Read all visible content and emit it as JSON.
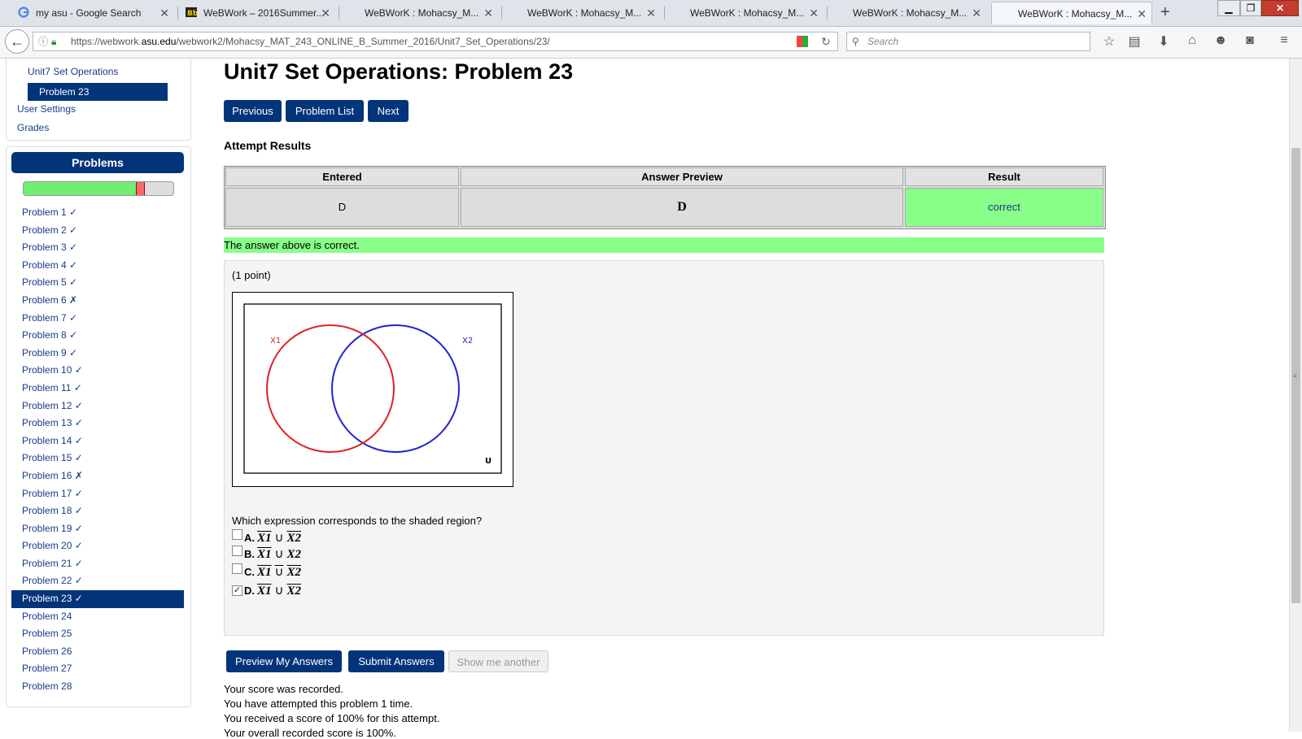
{
  "browser": {
    "tabs": [
      {
        "title": "my asu - Google Search",
        "icon": "google-icon"
      },
      {
        "title": "WeBWork – 2016Summer...",
        "icon": "bb-icon"
      },
      {
        "title": "WeBWorK : Mohacsy_M...",
        "icon": "none"
      },
      {
        "title": "WeBWorK : Mohacsy_M...",
        "icon": "none"
      },
      {
        "title": "WeBWorK : Mohacsy_M...",
        "icon": "none"
      },
      {
        "title": "WeBWorK : Mohacsy_M...",
        "icon": "none"
      },
      {
        "title": "WeBWorK : Mohacsy_M...",
        "icon": "none",
        "active": true
      }
    ],
    "url_prefix": "https://webwork.",
    "url_domain": "asu.edu",
    "url_path": "/webwork2/Mohacsy_MAT_243_ONLINE_B_Summer_2016/Unit7_Set_Operations/23/",
    "search_placeholder": "Search"
  },
  "sidebar": {
    "set_link": "Unit7 Set Operations",
    "current_problem": "Problem 23",
    "user_settings": "User Settings",
    "grades": "Grades",
    "problems_header": "Problems",
    "progress_fraction": 0.77,
    "problems": [
      "Problem 1 ✓",
      "Problem 2 ✓",
      "Problem 3 ✓",
      "Problem 4 ✓",
      "Problem 5 ✓",
      "Problem 6 ✗",
      "Problem 7 ✓",
      "Problem 8 ✓",
      "Problem 9 ✓",
      "Problem 10 ✓",
      "Problem 11 ✓",
      "Problem 12 ✓",
      "Problem 13 ✓",
      "Problem 14 ✓",
      "Problem 15 ✓",
      "Problem 16 ✗",
      "Problem 17 ✓",
      "Problem 18 ✓",
      "Problem 19 ✓",
      "Problem 20 ✓",
      "Problem 21 ✓",
      "Problem 22 ✓",
      "Problem 23 ✓",
      "Problem 24",
      "Problem 25",
      "Problem 26",
      "Problem 27",
      "Problem 28"
    ],
    "active_index": 22
  },
  "main": {
    "title": "Unit7 Set Operations: Problem 23",
    "buttons": {
      "previous": "Previous",
      "problem_list": "Problem List",
      "next": "Next"
    },
    "attempt_results_heading": "Attempt Results",
    "results_table": {
      "headers": [
        "Entered",
        "Answer Preview",
        "Result"
      ],
      "row": [
        "D",
        "D",
        "correct"
      ]
    },
    "correct_message": "The answer above is correct.",
    "points": "(1 point)",
    "venn": {
      "set1_label": "X1",
      "set2_label": "X2",
      "universe_label": "U",
      "set1_color": "#dd2222",
      "set2_color": "#2222cc",
      "shade_color": "#aaaaaa"
    },
    "question": "Which expression corresponds to the shaded region?",
    "choices": [
      {
        "letter": "A.",
        "left": "X1",
        "op": "∪",
        "right": "X2",
        "checked": false
      },
      {
        "letter": "B.",
        "left": "X1",
        "op": "∪",
        "right": "X2",
        "checked": false
      },
      {
        "letter": "C.",
        "left": "X1",
        "op": "∪",
        "right": "X2",
        "checked": false
      },
      {
        "letter": "D.",
        "left": "X1",
        "op": "∪",
        "right": "X2",
        "checked": true
      }
    ],
    "action_buttons": {
      "preview": "Preview My Answers",
      "submit": "Submit Answers",
      "show_another": "Show me another"
    },
    "score_lines": [
      "Your score was recorded.",
      "You have attempted this problem 1 time.",
      "You received a score of 100% for this attempt.",
      "Your overall recorded score is 100%."
    ]
  },
  "colors": {
    "accent": "#023479",
    "correct": "#88ff88"
  }
}
